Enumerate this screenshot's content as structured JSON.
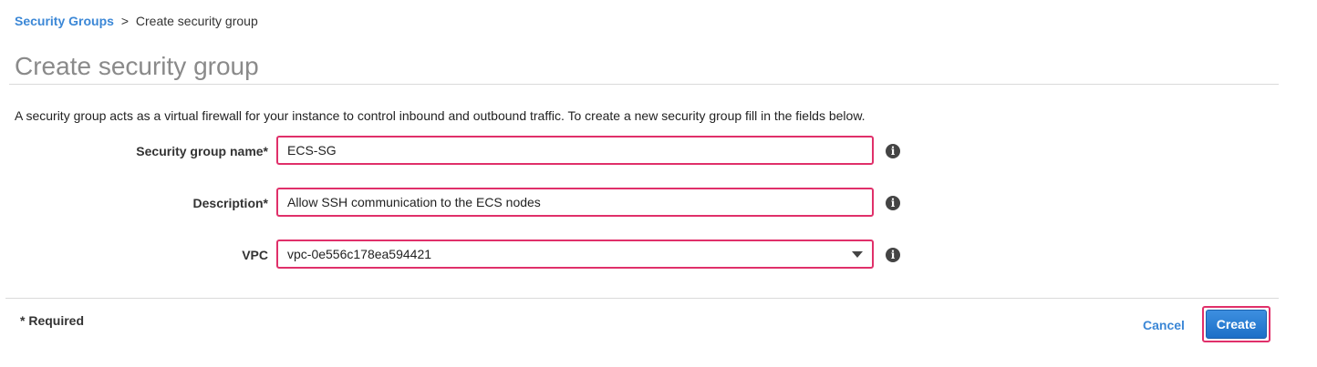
{
  "breadcrumb": {
    "parent": "Security Groups",
    "separator": ">",
    "current": "Create security group"
  },
  "page": {
    "title": "Create security group",
    "intro": "A security group acts as a virtual firewall for your instance to control inbound and outbound traffic. To create a new security group fill in the fields below."
  },
  "form": {
    "name": {
      "label": "Security group name*",
      "value": "ECS-SG"
    },
    "description": {
      "label": "Description*",
      "value": "Allow SSH communication to the ECS nodes"
    },
    "vpc": {
      "label": "VPC",
      "value": "vpc-0e556c178ea594421"
    },
    "info_icon": {
      "glyph": "i",
      "icon": "info-circle-icon"
    }
  },
  "footer": {
    "required_note": "* Required",
    "cancel_label": "Cancel",
    "create_label": "Create"
  },
  "colors": {
    "link": "#3b87d6",
    "highlight": "#e0306a",
    "primary": "#1c6fc7",
    "title": "#8a8a8a"
  }
}
